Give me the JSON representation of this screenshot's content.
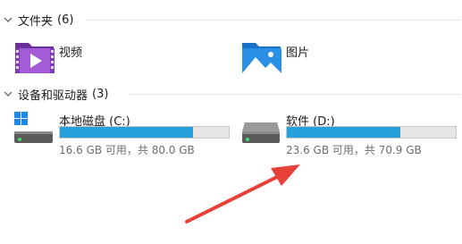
{
  "sections": {
    "folders": {
      "title": "文件夹",
      "count": "(6)"
    },
    "drives": {
      "title": "设备和驱动器",
      "count": "(3)"
    }
  },
  "folders": [
    {
      "label": "视频",
      "icon": "video-folder-icon"
    },
    {
      "label": "图片",
      "icon": "pictures-folder-icon"
    }
  ],
  "drives": [
    {
      "name": "本地磁盘 (C:)",
      "info": "16.6 GB 可用，共 80.0 GB",
      "used_fraction": 0.79,
      "icon": "windows-drive-icon"
    },
    {
      "name": "软件 (D:)",
      "info": "23.6 GB 可用，共 70.9 GB",
      "used_fraction": 0.67,
      "icon": "hard-drive-icon"
    }
  ],
  "colors": {
    "bar_fill": "#26a0da",
    "bar_track": "#e6e6e6",
    "annotation_arrow": "#e8413a"
  }
}
